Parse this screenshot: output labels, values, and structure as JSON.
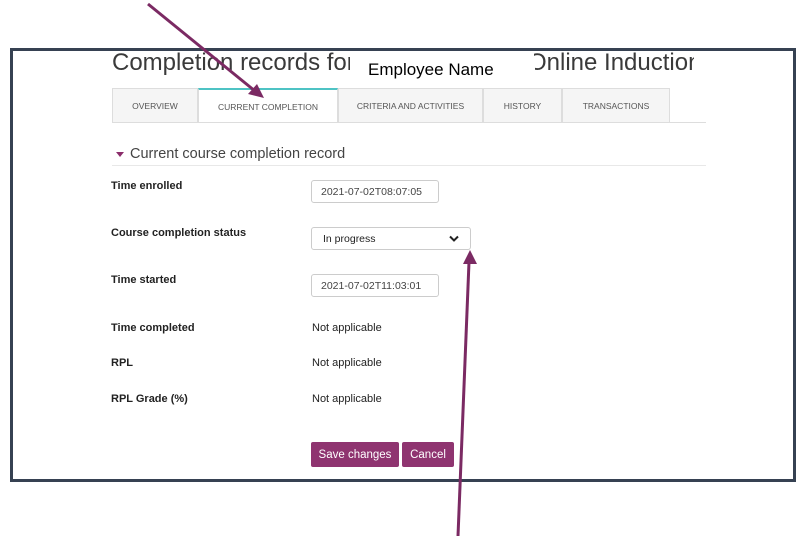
{
  "header": {
    "title_prefix": "Completion records for",
    "employee_name": "Employee Name",
    "title_suffix": "Online Induction"
  },
  "tabs": [
    {
      "label": "Overview"
    },
    {
      "label": "Current completion"
    },
    {
      "label": "Criteria and activities"
    },
    {
      "label": "History"
    },
    {
      "label": "Transactions"
    }
  ],
  "section": {
    "title": "Current course completion record"
  },
  "fields": {
    "time_enrolled": {
      "label": "Time enrolled",
      "value": "2021-07-02T08:07:05"
    },
    "status": {
      "label": "Course completion status",
      "value": "In progress"
    },
    "time_started": {
      "label": "Time started",
      "value": "2021-07-02T11:03:01"
    },
    "time_completed": {
      "label": "Time completed",
      "value": "Not applicable"
    },
    "rpl": {
      "label": "RPL",
      "value": "Not applicable"
    },
    "rpl_grade": {
      "label": "RPL Grade (%)",
      "value": "Not applicable"
    }
  },
  "buttons": {
    "save": "Save changes",
    "cancel": "Cancel"
  },
  "colors": {
    "accent": "#8f3470",
    "tab_active": "#4ec3c4",
    "arrow": "#7b2a63",
    "frame": "#364152"
  }
}
